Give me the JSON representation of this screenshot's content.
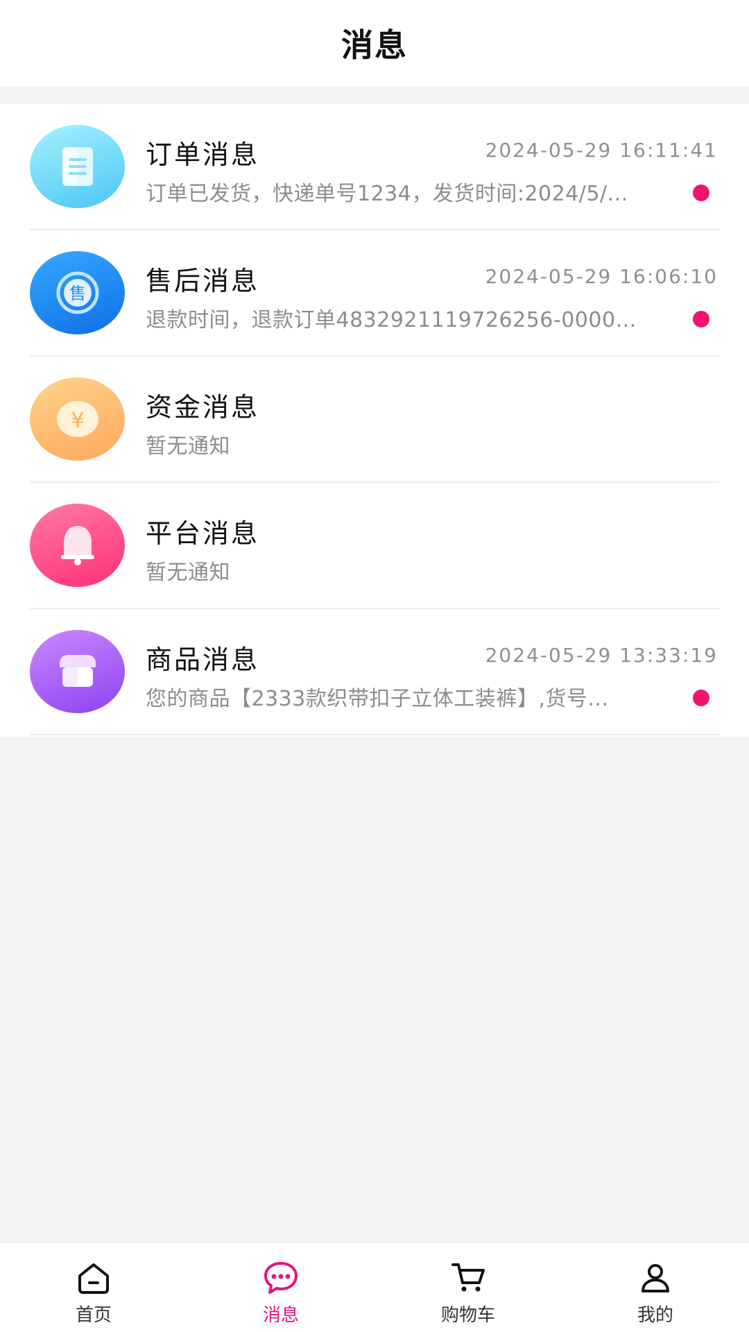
{
  "header": {
    "title": "消息"
  },
  "messages": [
    {
      "title": "订单消息",
      "time": "2024-05-29 16:11:41",
      "preview": "订单已发货，快递单号1234，发货时间:2024/5/...",
      "icon": "clipboard-icon"
    },
    {
      "title": "售后消息",
      "time": "2024-05-29 16:06:10",
      "preview": "退款时间，退款订单4832921119726256-0000...",
      "icon": "after-sale-icon",
      "icon_text": "售"
    },
    {
      "title": "资金消息",
      "time": "",
      "preview": "暂无通知",
      "icon": "yuan-coin-icon",
      "icon_text": "¥"
    },
    {
      "title": "平台消息",
      "time": "",
      "preview": "暂无通知",
      "icon": "bell-icon"
    },
    {
      "title": "商品消息",
      "time": "2024-05-29 13:33:19",
      "preview": "您的商品【2333款织带扣子立体工装裤】,货号...",
      "icon": "store-icon"
    }
  ],
  "tabbar": [
    {
      "label": "首页",
      "icon": "home-icon"
    },
    {
      "label": "消息",
      "icon": "chat-bubble-icon",
      "active": true
    },
    {
      "label": "购物车",
      "icon": "cart-icon"
    },
    {
      "label": "我的",
      "icon": "user-icon"
    }
  ],
  "colors": {
    "accent": "#e3157d",
    "unread_dot": "#f1136e"
  }
}
